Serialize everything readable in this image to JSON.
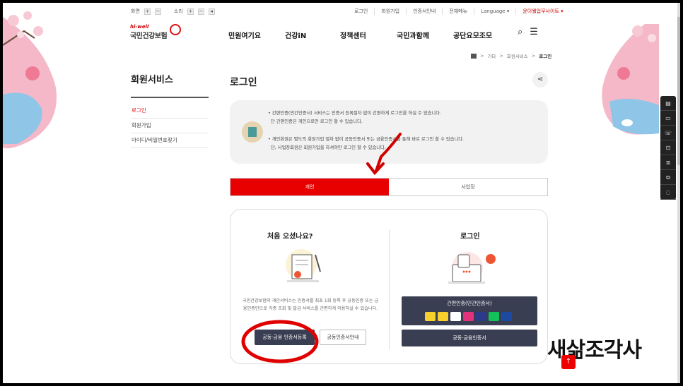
{
  "util": {
    "screen_label": "화면",
    "sound_label": "소리",
    "links": [
      "로그인",
      "회원가입",
      "인증서안내",
      "전체메뉴",
      "Language ▾",
      "윤이웰업무사이트 ▾"
    ]
  },
  "logo": {
    "tagline": "hi-well",
    "name": "국민건강보험"
  },
  "gnb": [
    "민원여기요",
    "건강iN",
    "정책센터",
    "국민과함께",
    "공단요모조모"
  ],
  "breadcrumb": {
    "items": [
      "기타",
      "회원서비스"
    ],
    "current": "로그인"
  },
  "sidebar": {
    "title": "회원서비스",
    "items": [
      {
        "label": "로그인"
      },
      {
        "label": "회원가입"
      },
      {
        "label": "아이디/비밀번호찾기"
      }
    ]
  },
  "page_title": "로그인",
  "notice": {
    "line1": "• 간편인증(민간인증서) 서비스는 인증서 등록절차 없이 간편하게 로그인을 하실 수 있습니다.",
    "line2": "단 간편인증은 개인으로만 로그인 할 수 있습니다.",
    "line3": "• 개인회원은 별도의 회원가입 절차 없이 공동인증서 또는 금융인증서를 통해 바로 로그인 할 수 있습니다.",
    "line4": "단, 사업장회원은 회원가입을 하셔야만 로그인 할 수 있습니다."
  },
  "tabs": {
    "personal": "개인",
    "business": "사업장"
  },
  "first_visit": {
    "title": "처음 오셨나요?",
    "desc": "국민건강보험의 개인서비스는 인증서를 최초 1회 등록 후 공동인증 또는 금융인증만으로 각종 조회 및 발급 서비스를 간편하게 이용하실 수 있습니다.",
    "register_button": "공동·금융 인증서등록",
    "guide_button": "공동인증서안내"
  },
  "login": {
    "title": "로그인",
    "simple_auth_button": "간편인증(민간인증서)",
    "cert_button": "공동·금융인증서"
  },
  "overlay_text": "새삶조각사",
  "quick_icons": [
    "document-icon",
    "monitor-icon",
    "phone-icon",
    "lock-icon",
    "list-icon",
    "copy-icon",
    "chat-icon"
  ],
  "colors": {
    "accent": "#e80000",
    "dark_button": "#3a3e52"
  }
}
